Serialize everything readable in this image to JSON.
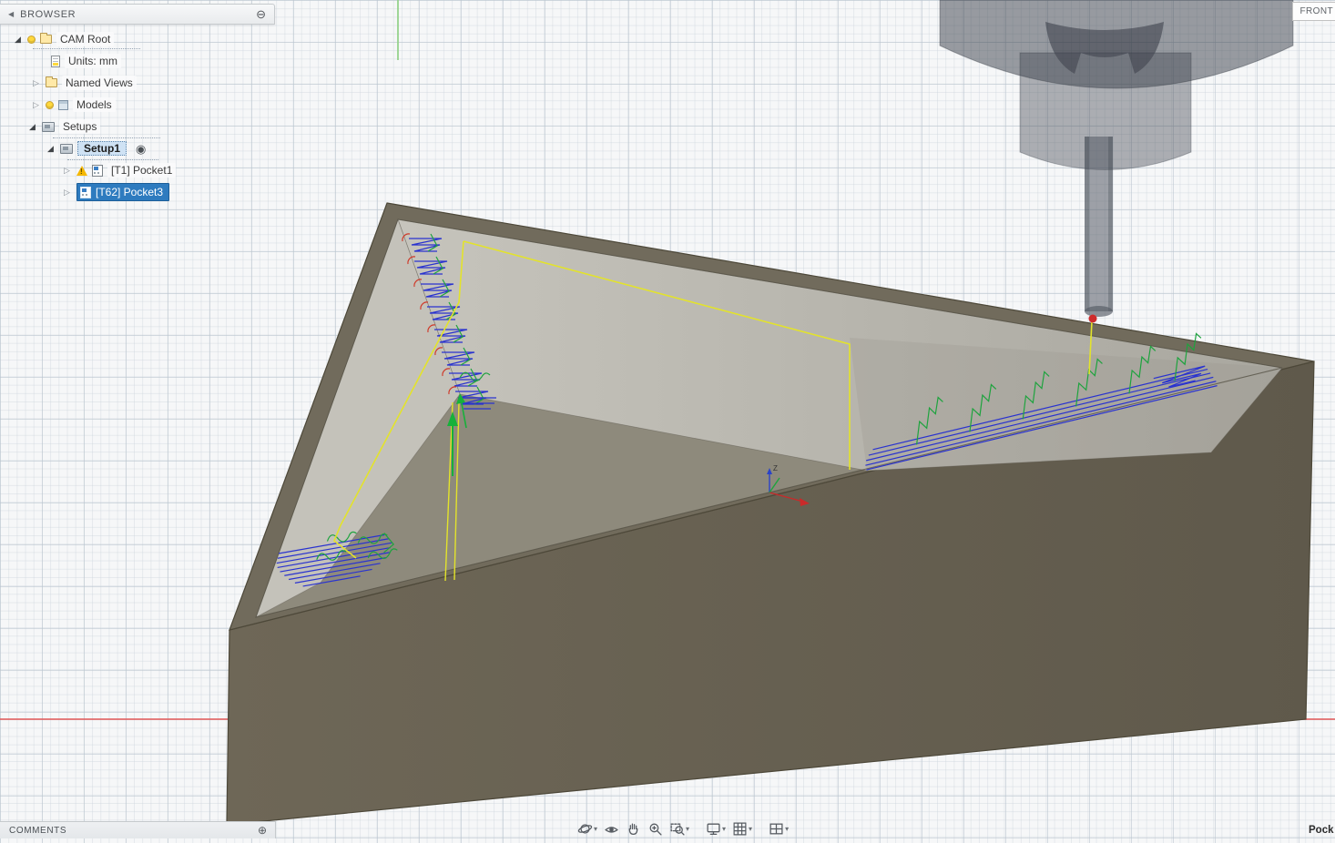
{
  "glyphs": {
    "expanded": "◢",
    "collapsed": "▷",
    "collapse_left": "◀",
    "minus_circle": "⊖",
    "plus_circle": "⊕",
    "target": "◉",
    "caret": "▾"
  },
  "browser": {
    "title": "BROWSER",
    "items": [
      {
        "label": "CAM Root"
      },
      {
        "label": "Units: mm"
      },
      {
        "label": "Named Views"
      },
      {
        "label": "Models"
      },
      {
        "label": "Setups"
      },
      {
        "label": "Setup1"
      },
      {
        "label": "[T1] Pocket1"
      },
      {
        "label": "[T62] Pocket3"
      }
    ]
  },
  "viewport": {
    "axis_z_label": "Z"
  },
  "viewcube": {
    "front_label": "FRONT"
  },
  "comments_bar": {
    "label": "COMMENTS"
  },
  "status_bar": {
    "operation_label": "Pock"
  },
  "toolbar": {
    "items": [
      {
        "icon": "orbit-icon",
        "has_caret": true
      },
      {
        "icon": "look-at-icon",
        "has_caret": false
      },
      {
        "icon": "pan-icon",
        "has_caret": false
      },
      {
        "icon": "zoom-icon",
        "has_caret": false
      },
      {
        "icon": "zoom-window-icon",
        "has_caret": true
      },
      {
        "icon": "display-settings-icon",
        "has_caret": true
      },
      {
        "icon": "grid-display-icon",
        "has_caret": true
      },
      {
        "icon": "viewports-icon",
        "has_caret": true
      }
    ]
  },
  "colors": {
    "selection_blue": "#2e7bbf",
    "selection_soft": "#cfe2f4",
    "toolpath_blue": "#2a33cf",
    "toolpath_green": "#1ea33e",
    "rapid_yellow": "#e3e32b",
    "toolpath_red": "#cf3a2a",
    "warning_yellow": "#f5b800"
  }
}
